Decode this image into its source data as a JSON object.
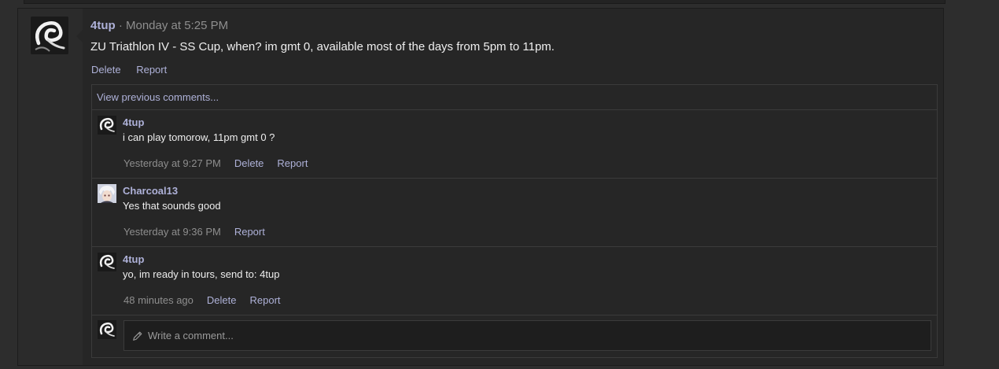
{
  "post": {
    "author": "4tup",
    "meta": " · Monday at 5:25 PM",
    "text": "ZU Triathlon IV - SS Cup, when? im gmt 0, available most of the days from 5pm to 11pm.",
    "actions": {
      "delete": "Delete",
      "report": "Report"
    }
  },
  "comments_section": {
    "view_previous": "View previous comments...",
    "items": [
      {
        "author": "4tup",
        "text": "i can play tomorow, 11pm gmt 0 ?",
        "time": "Yesterday at 9:27 PM",
        "delete": "Delete",
        "report": "Report"
      },
      {
        "author": "Charcoal13",
        "text": "Yes that sounds good",
        "time": "Yesterday at 9:36 PM",
        "report": "Report"
      },
      {
        "author": "4tup",
        "text": "yo, im ready in tours, send to: 4tup",
        "time": "48 minutes ago",
        "delete": "Delete",
        "report": "Report"
      }
    ],
    "write_placeholder": "Write a comment..."
  },
  "icons": {
    "avatar_main": "logo-avatar-icon",
    "avatar_alt": "anime-avatar-icon",
    "compose": "pencil-icon"
  },
  "colors": {
    "link": "#aeb1d8",
    "meta": "#8e8e8e",
    "text": "#eeeeee",
    "background": "#262626"
  }
}
